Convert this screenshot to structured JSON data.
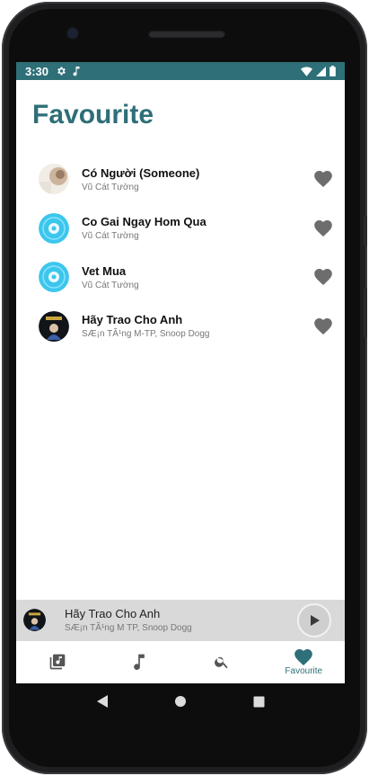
{
  "status_bar": {
    "time": "3:30",
    "icons_left": [
      "gear-icon",
      "music-note-icon"
    ],
    "icons_right": [
      "wifi-icon",
      "signal-icon",
      "battery-icon"
    ],
    "color": "#2e6f78"
  },
  "page": {
    "title": "Favourite",
    "accent": "#2e6f78"
  },
  "favourites": [
    {
      "title": "Có Người (Someone)",
      "artist": "Vũ Cát Tường",
      "art": "album-art-light"
    },
    {
      "title": "Co Gai Ngay Hom Qua",
      "artist": "Vũ Cát Tường",
      "art": "disc-icon"
    },
    {
      "title": "Vet Mua",
      "artist": "Vũ Cát Tường",
      "art": "disc-icon"
    },
    {
      "title": "Hãy Trao Cho Anh",
      "artist": "SÆ¡n TÃ¹ng M-TP, Snoop Dogg",
      "art": "album-art-dark"
    }
  ],
  "mini_player": {
    "title": "Hãy Trao Cho Anh",
    "artist": "SÆ¡n TÃ¹ng M TP, Snoop Dogg",
    "button": "play-icon"
  },
  "bottom_nav": [
    {
      "icon": "library-icon",
      "label": "",
      "active": false
    },
    {
      "icon": "music-note-icon",
      "label": "",
      "active": false
    },
    {
      "icon": "search-icon",
      "label": "",
      "active": false
    },
    {
      "icon": "heart-icon",
      "label": "Favourite",
      "active": true
    }
  ],
  "system_nav": [
    "back-icon",
    "home-icon",
    "recents-icon"
  ]
}
